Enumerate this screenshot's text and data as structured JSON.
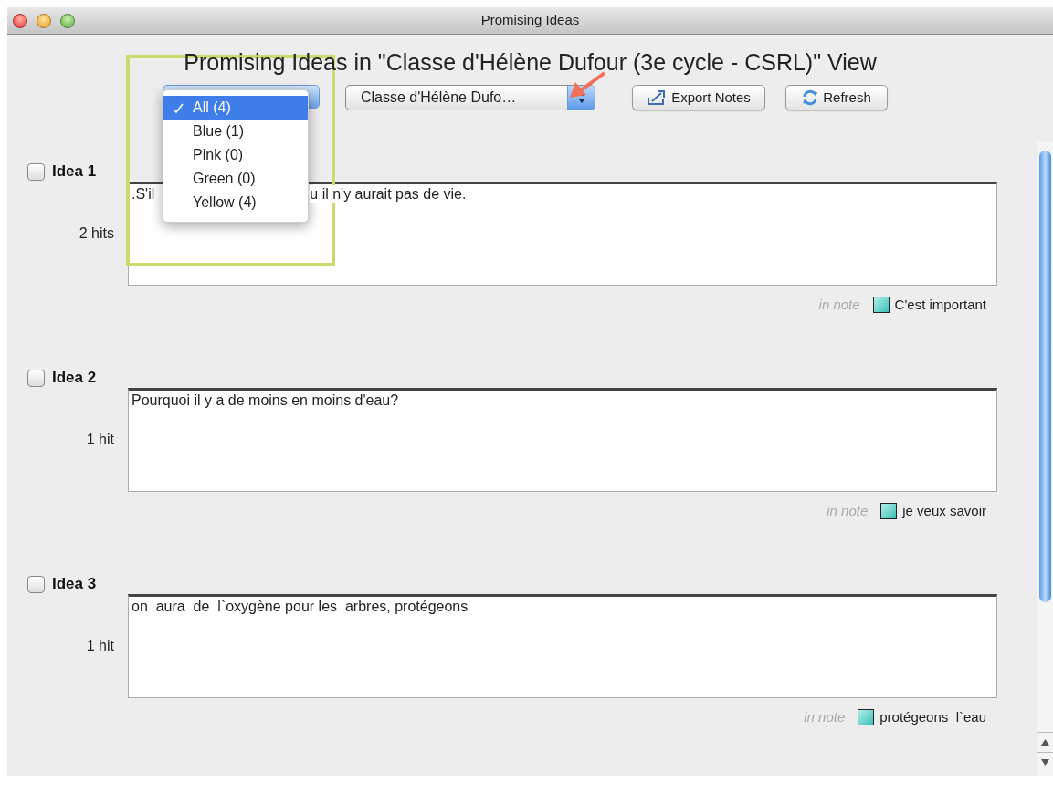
{
  "window": {
    "title": "Promising Ideas"
  },
  "heading": "Promising Ideas in \"Classe d'Hélène Dufour (3e cycle - CSRL)\" View",
  "filter_menu": {
    "items": [
      {
        "label": "All (4)",
        "selected": true
      },
      {
        "label": "Blue (1)",
        "selected": false
      },
      {
        "label": "Pink (0)",
        "selected": false
      },
      {
        "label": "Green (0)",
        "selected": false
      },
      {
        "label": "Yellow (4)",
        "selected": false
      }
    ]
  },
  "view_select": {
    "value": "Classe d'Hélène Dufo…"
  },
  "buttons": [
    {
      "label": "Export Notes",
      "kind": "export"
    },
    {
      "label": "Refresh",
      "kind": "refresh"
    }
  ],
  "ideas": [
    {
      "title": "Idea 1",
      "checked": false,
      "hits": "2 hits",
      "text": [
        ".S'il",
        "u il n'y aurait pas de vie."
      ],
      "source": "in note",
      "note": "C'est important"
    },
    {
      "title": "Idea 2",
      "checked": false,
      "hits": "1 hit",
      "text": [
        "Pourquoi il y a de moins en moins d'eau?"
      ],
      "source": "in note",
      "note": "je veux savoir"
    },
    {
      "title": "Idea 3",
      "checked": false,
      "hits": "1 hit",
      "text": [
        "on  aura  de  l`oxygène pour les  arbres, protégeons"
      ],
      "source": "in note",
      "note": "protégeons  l`eau"
    }
  ]
}
